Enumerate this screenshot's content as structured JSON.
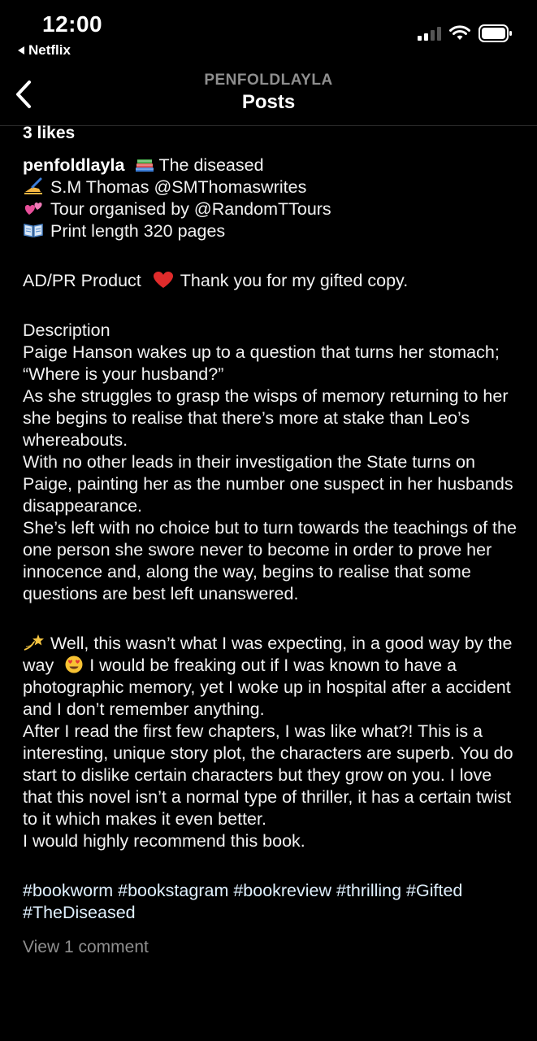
{
  "status_bar": {
    "time": "12:00",
    "back_app": "Netflix"
  },
  "header": {
    "username": "PENFOLDLAYLA",
    "title": "Posts"
  },
  "post": {
    "likes": "3 likes",
    "username": "penfoldlayla",
    "book_title": "The diseased",
    "author": "S.M Thomas @SMThomaswrites",
    "tour": "Tour organised by @RandomTTours",
    "print_length": "Print length 320 pages",
    "ad_label": "AD/PR Product",
    "thanks": "Thank you for my gifted copy.",
    "description_heading": "Description",
    "description_paragraphs": [
      "Paige Hanson wakes up to a question that turns her stomach; “Where is your husband?”",
      "As she struggles to grasp the wisps of memory returning to her she begins to realise that there’s more at stake than Leo’s whereabouts.",
      "With no other leads in their investigation the State turns on Paige, painting her as the number one suspect in her husbands disappearance.",
      "She’s left with no choice but to turn towards the teachings of the one person she swore never to become in order to prove her innocence and, along the way, begins to realise that some questions are best left unanswered."
    ],
    "review_intro": "Well, this wasn’t what I was expecting, in a good way by the way",
    "review_intro_cont": "I would be freaking out if I was known to have a photographic memory, yet I woke up in hospital after a accident and I don’t remember anything.",
    "review_paragraphs": [
      "After I read the first few chapters, I was like what?! This is a interesting, unique story plot, the characters are superb. You do start to dislike certain characters but they grow on you. I love that this novel isn’t a normal type of thriller, it has a certain twist to it which makes it even better.",
      "I would highly recommend this book."
    ],
    "hashtags": "#bookworm #bookstagram #bookreview #thrilling #Gifted #TheDiseased",
    "view_comments": "View 1 comment"
  },
  "icons": {
    "books": "books-icon",
    "writing_hand": "writing-hand-icon",
    "hearts": "two-hearts-icon",
    "open_book": "open-book-icon",
    "red_heart": "red-heart-icon",
    "dizzy": "dizzy-star-icon",
    "heart_eyes": "heart-eyes-icon"
  },
  "colors": {
    "background": "#000000",
    "text": "#f2f2f2",
    "muted": "#8e8e8e",
    "heart": "#e0245e"
  }
}
